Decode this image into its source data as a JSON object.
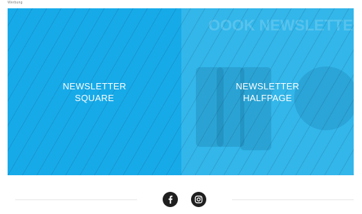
{
  "top_label": "Werbung",
  "zones": {
    "square": {
      "line1": "NEWSLETTER",
      "line2": "SQUARE"
    },
    "halfpage": {
      "line1": "NEWSLETTER",
      "line2": "HALFPAGE"
    }
  },
  "background_mock_text": "OOOK NEWSLETTERS",
  "footer": {
    "social": [
      {
        "name": "facebook-icon"
      },
      {
        "name": "instagram-icon"
      }
    ]
  },
  "colors": {
    "banner": "#33b6ea",
    "square": "#17aae9",
    "icon_bg": "#1f1f1f"
  }
}
